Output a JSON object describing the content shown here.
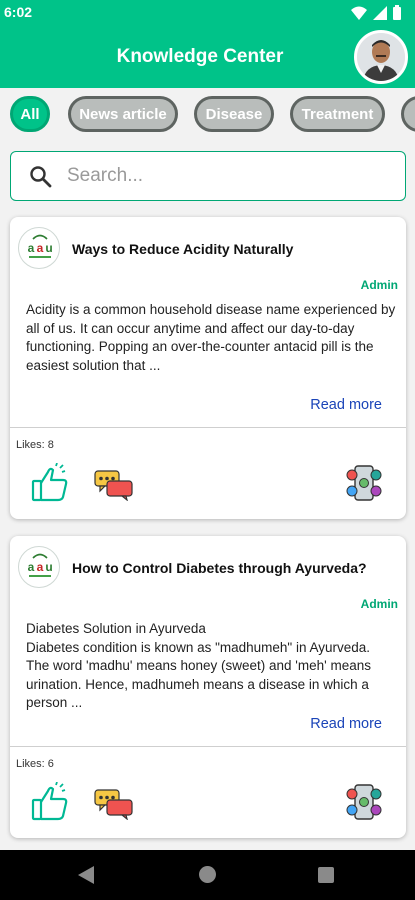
{
  "status": {
    "time": "6:02"
  },
  "header": {
    "title": "Knowledge Center"
  },
  "chips": [
    "All",
    "News article",
    "Disease",
    "Treatment"
  ],
  "search": {
    "placeholder": "Search..."
  },
  "posts": [
    {
      "title": "Ways to Reduce Acidity Naturally",
      "author": "Admin",
      "excerpt": "Acidity is a common household disease name experienced by all of us. It can occur anytime and affect our day-to-day functioning. Popping an over-the-counter antacid pill is the easiest solution that ...",
      "read_more": "Read more",
      "likes": "Likes: 8"
    },
    {
      "title": "How to Control Diabetes through Ayurveda?",
      "author": "Admin",
      "excerpt": "Diabetes Solution in Ayurveda\nDiabetes condition is known as \"madhumeh\" in Ayurveda. The word 'madhu' means honey (sweet) and 'meh' means urination. Hence, madhumeh means a disease in which a person ...",
      "read_more": "Read more",
      "likes": "Likes: 6"
    }
  ],
  "colors": {
    "brand": "#00c389",
    "link": "#1a44b8",
    "chip_inactive": "#b9bdbb"
  }
}
